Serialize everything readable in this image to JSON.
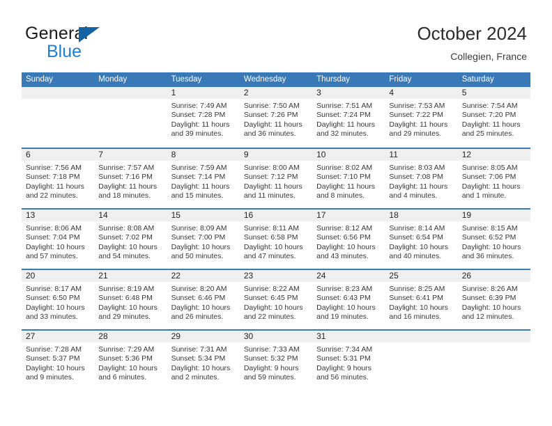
{
  "brand": {
    "name_primary": "General",
    "name_secondary": "Blue",
    "accent_color": "#1464a5",
    "secondary_color": "#1b7fd4"
  },
  "header": {
    "title": "October 2024",
    "subtitle": "Collegien, France"
  },
  "theme": {
    "header_blue": "#3a79b8",
    "day_band_gray": "#efefef",
    "text_color": "#363636"
  },
  "weekdays": [
    "Sunday",
    "Monday",
    "Tuesday",
    "Wednesday",
    "Thursday",
    "Friday",
    "Saturday"
  ],
  "weeks": [
    [
      {
        "day": "",
        "lines": []
      },
      {
        "day": "",
        "lines": []
      },
      {
        "day": "1",
        "lines": [
          "Sunrise: 7:49 AM",
          "Sunset: 7:28 PM",
          "Daylight: 11 hours",
          "and 39 minutes."
        ]
      },
      {
        "day": "2",
        "lines": [
          "Sunrise: 7:50 AM",
          "Sunset: 7:26 PM",
          "Daylight: 11 hours",
          "and 36 minutes."
        ]
      },
      {
        "day": "3",
        "lines": [
          "Sunrise: 7:51 AM",
          "Sunset: 7:24 PM",
          "Daylight: 11 hours",
          "and 32 minutes."
        ]
      },
      {
        "day": "4",
        "lines": [
          "Sunrise: 7:53 AM",
          "Sunset: 7:22 PM",
          "Daylight: 11 hours",
          "and 29 minutes."
        ]
      },
      {
        "day": "5",
        "lines": [
          "Sunrise: 7:54 AM",
          "Sunset: 7:20 PM",
          "Daylight: 11 hours",
          "and 25 minutes."
        ]
      }
    ],
    [
      {
        "day": "6",
        "lines": [
          "Sunrise: 7:56 AM",
          "Sunset: 7:18 PM",
          "Daylight: 11 hours",
          "and 22 minutes."
        ]
      },
      {
        "day": "7",
        "lines": [
          "Sunrise: 7:57 AM",
          "Sunset: 7:16 PM",
          "Daylight: 11 hours",
          "and 18 minutes."
        ]
      },
      {
        "day": "8",
        "lines": [
          "Sunrise: 7:59 AM",
          "Sunset: 7:14 PM",
          "Daylight: 11 hours",
          "and 15 minutes."
        ]
      },
      {
        "day": "9",
        "lines": [
          "Sunrise: 8:00 AM",
          "Sunset: 7:12 PM",
          "Daylight: 11 hours",
          "and 11 minutes."
        ]
      },
      {
        "day": "10",
        "lines": [
          "Sunrise: 8:02 AM",
          "Sunset: 7:10 PM",
          "Daylight: 11 hours",
          "and 8 minutes."
        ]
      },
      {
        "day": "11",
        "lines": [
          "Sunrise: 8:03 AM",
          "Sunset: 7:08 PM",
          "Daylight: 11 hours",
          "and 4 minutes."
        ]
      },
      {
        "day": "12",
        "lines": [
          "Sunrise: 8:05 AM",
          "Sunset: 7:06 PM",
          "Daylight: 11 hours",
          "and 1 minute."
        ]
      }
    ],
    [
      {
        "day": "13",
        "lines": [
          "Sunrise: 8:06 AM",
          "Sunset: 7:04 PM",
          "Daylight: 10 hours",
          "and 57 minutes."
        ]
      },
      {
        "day": "14",
        "lines": [
          "Sunrise: 8:08 AM",
          "Sunset: 7:02 PM",
          "Daylight: 10 hours",
          "and 54 minutes."
        ]
      },
      {
        "day": "15",
        "lines": [
          "Sunrise: 8:09 AM",
          "Sunset: 7:00 PM",
          "Daylight: 10 hours",
          "and 50 minutes."
        ]
      },
      {
        "day": "16",
        "lines": [
          "Sunrise: 8:11 AM",
          "Sunset: 6:58 PM",
          "Daylight: 10 hours",
          "and 47 minutes."
        ]
      },
      {
        "day": "17",
        "lines": [
          "Sunrise: 8:12 AM",
          "Sunset: 6:56 PM",
          "Daylight: 10 hours",
          "and 43 minutes."
        ]
      },
      {
        "day": "18",
        "lines": [
          "Sunrise: 8:14 AM",
          "Sunset: 6:54 PM",
          "Daylight: 10 hours",
          "and 40 minutes."
        ]
      },
      {
        "day": "19",
        "lines": [
          "Sunrise: 8:15 AM",
          "Sunset: 6:52 PM",
          "Daylight: 10 hours",
          "and 36 minutes."
        ]
      }
    ],
    [
      {
        "day": "20",
        "lines": [
          "Sunrise: 8:17 AM",
          "Sunset: 6:50 PM",
          "Daylight: 10 hours",
          "and 33 minutes."
        ]
      },
      {
        "day": "21",
        "lines": [
          "Sunrise: 8:19 AM",
          "Sunset: 6:48 PM",
          "Daylight: 10 hours",
          "and 29 minutes."
        ]
      },
      {
        "day": "22",
        "lines": [
          "Sunrise: 8:20 AM",
          "Sunset: 6:46 PM",
          "Daylight: 10 hours",
          "and 26 minutes."
        ]
      },
      {
        "day": "23",
        "lines": [
          "Sunrise: 8:22 AM",
          "Sunset: 6:45 PM",
          "Daylight: 10 hours",
          "and 22 minutes."
        ]
      },
      {
        "day": "24",
        "lines": [
          "Sunrise: 8:23 AM",
          "Sunset: 6:43 PM",
          "Daylight: 10 hours",
          "and 19 minutes."
        ]
      },
      {
        "day": "25",
        "lines": [
          "Sunrise: 8:25 AM",
          "Sunset: 6:41 PM",
          "Daylight: 10 hours",
          "and 16 minutes."
        ]
      },
      {
        "day": "26",
        "lines": [
          "Sunrise: 8:26 AM",
          "Sunset: 6:39 PM",
          "Daylight: 10 hours",
          "and 12 minutes."
        ]
      }
    ],
    [
      {
        "day": "27",
        "lines": [
          "Sunrise: 7:28 AM",
          "Sunset: 5:37 PM",
          "Daylight: 10 hours",
          "and 9 minutes."
        ]
      },
      {
        "day": "28",
        "lines": [
          "Sunrise: 7:29 AM",
          "Sunset: 5:36 PM",
          "Daylight: 10 hours",
          "and 6 minutes."
        ]
      },
      {
        "day": "29",
        "lines": [
          "Sunrise: 7:31 AM",
          "Sunset: 5:34 PM",
          "Daylight: 10 hours",
          "and 2 minutes."
        ]
      },
      {
        "day": "30",
        "lines": [
          "Sunrise: 7:33 AM",
          "Sunset: 5:32 PM",
          "Daylight: 9 hours",
          "and 59 minutes."
        ]
      },
      {
        "day": "31",
        "lines": [
          "Sunrise: 7:34 AM",
          "Sunset: 5:31 PM",
          "Daylight: 9 hours",
          "and 56 minutes."
        ]
      },
      {
        "day": "",
        "lines": []
      },
      {
        "day": "",
        "lines": []
      }
    ]
  ]
}
